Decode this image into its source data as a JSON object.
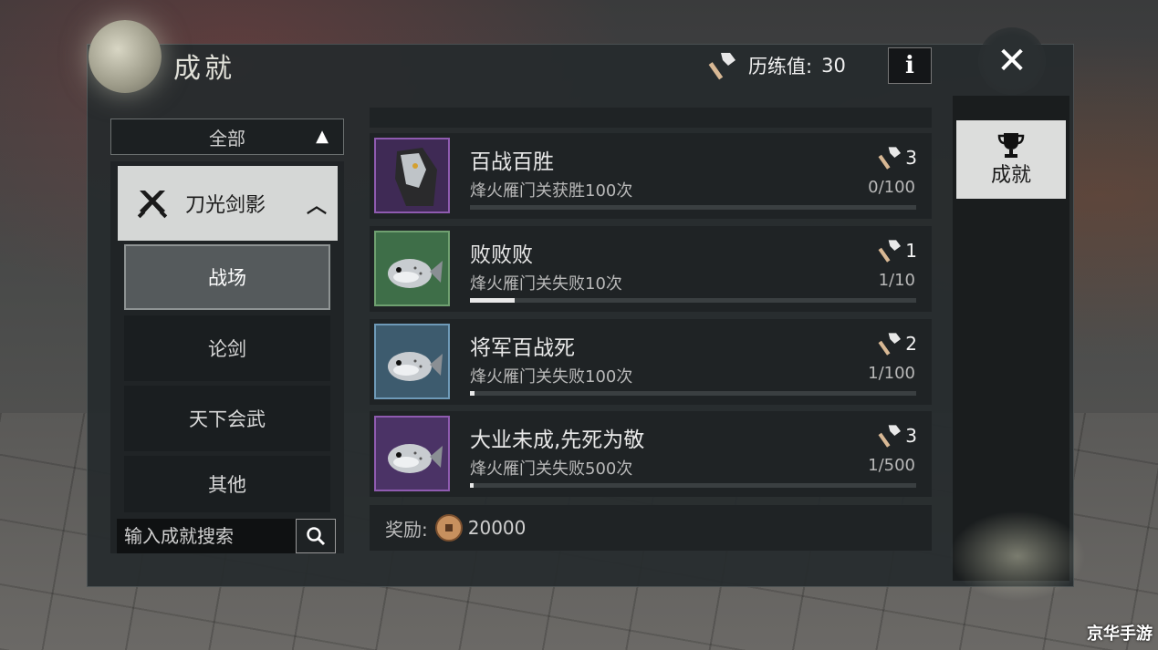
{
  "header": {
    "title": "成就",
    "exp_label": "历练值:",
    "exp_value": "30",
    "info_label": "i",
    "close_label": "✕"
  },
  "filter": {
    "label": "全部"
  },
  "category": {
    "label": "刀光剑影"
  },
  "subcategories": [
    {
      "label": "战场"
    },
    {
      "label": "论剑"
    },
    {
      "label": "天下会武"
    },
    {
      "label": "其他"
    }
  ],
  "search": {
    "placeholder": "输入成就搜索"
  },
  "achievements": [
    {
      "name": "百战百胜",
      "desc": "烽火雁门关获胜100次",
      "points": "3",
      "progress": "0/100",
      "ratio": 0,
      "frame": "#8f5bb0",
      "bg": "#3f2a55",
      "icon": "horse-mask"
    },
    {
      "name": "败败败",
      "desc": "烽火雁门关失败10次",
      "points": "1",
      "progress": "1/10",
      "ratio": 0.1,
      "frame": "#6fa070",
      "bg": "#3e6e48",
      "icon": "pufferfish"
    },
    {
      "name": "将军百战死",
      "desc": "烽火雁门关失败100次",
      "points": "2",
      "progress": "1/100",
      "ratio": 0.01,
      "frame": "#6e9ab8",
      "bg": "#3d5b6e",
      "icon": "pufferfish"
    },
    {
      "name": "大业未成,先死为敬",
      "desc": "烽火雁门关失败500次",
      "points": "3",
      "progress": "1/500",
      "ratio": 0.002,
      "frame": "#8f5bb0",
      "bg": "#4b3366",
      "icon": "pufferfish"
    }
  ],
  "reward": {
    "label": "奖励:",
    "amount": "20000"
  },
  "right_tab": {
    "label": "成就"
  },
  "watermark": "京华手游"
}
